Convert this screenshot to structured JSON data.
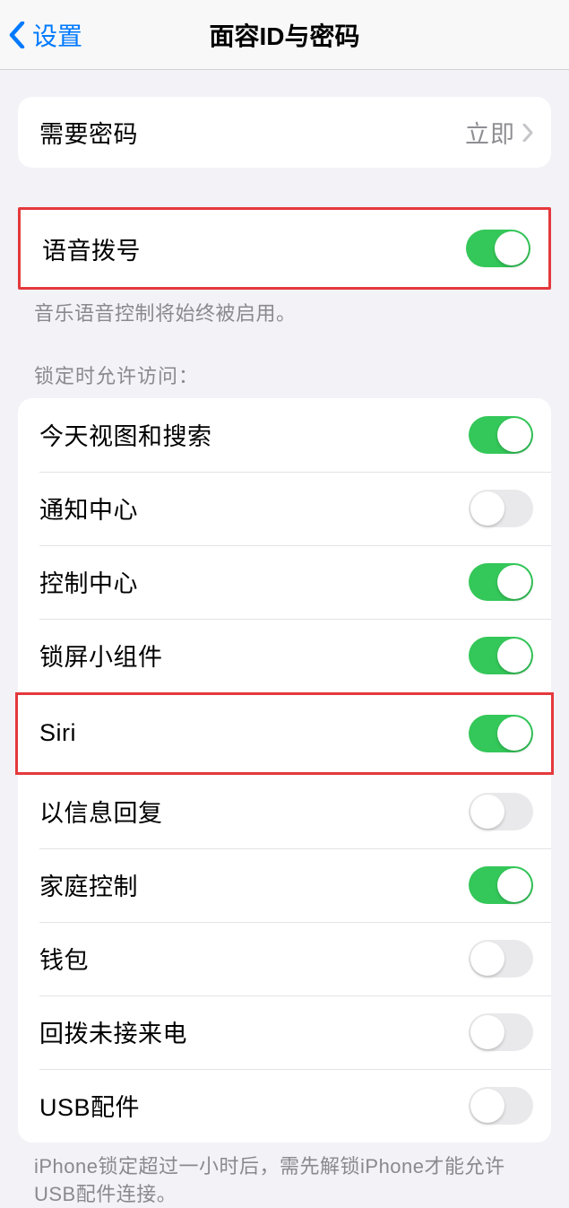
{
  "navbar": {
    "back_label": "设置",
    "title": "面容ID与密码"
  },
  "require_passcode": {
    "label": "需要密码",
    "value": "立即"
  },
  "voice_dial": {
    "label": "语音拨号",
    "footer": "音乐语音控制将始终被启用。"
  },
  "lock_section": {
    "header": "锁定时允许访问：",
    "footer": "iPhone锁定超过一小时后，需先解锁iPhone才能允许USB配件连接。",
    "items": [
      {
        "label": "今天视图和搜索",
        "on": true
      },
      {
        "label": "通知中心",
        "on": false
      },
      {
        "label": "控制中心",
        "on": true
      },
      {
        "label": "锁屏小组件",
        "on": true
      },
      {
        "label": "Siri",
        "on": true
      },
      {
        "label": "以信息回复",
        "on": false
      },
      {
        "label": "家庭控制",
        "on": true
      },
      {
        "label": "钱包",
        "on": false
      },
      {
        "label": "回拨未接来电",
        "on": false
      },
      {
        "label": "USB配件",
        "on": false
      }
    ]
  }
}
